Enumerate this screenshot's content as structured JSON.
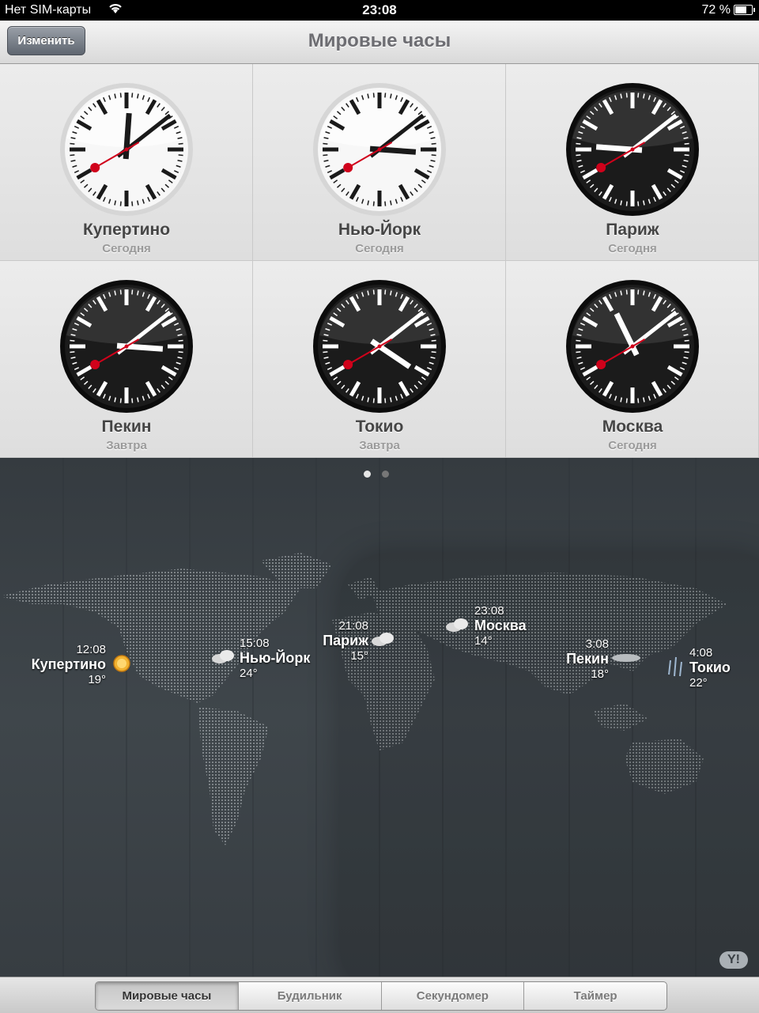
{
  "status": {
    "carrier": "Нет SIM-карты",
    "time": "23:08",
    "battery": "72 %",
    "battery_level": 0.72
  },
  "navbar": {
    "title": "Мировые часы",
    "edit_label": "Изменить"
  },
  "clocks": [
    {
      "city": "Купертино",
      "day": "Сегодня",
      "theme": "light",
      "hour": 12,
      "minute": 8,
      "second": 40
    },
    {
      "city": "Нью-Йорк",
      "day": "Сегодня",
      "theme": "light",
      "hour": 15,
      "minute": 8,
      "second": 40
    },
    {
      "city": "Париж",
      "day": "Сегодня",
      "theme": "dark",
      "hour": 21,
      "minute": 8,
      "second": 40
    },
    {
      "city": "Пекин",
      "day": "Завтра",
      "theme": "dark",
      "hour": 3,
      "minute": 8,
      "second": 40
    },
    {
      "city": "Токио",
      "day": "Завтра",
      "theme": "dark",
      "hour": 4,
      "minute": 8,
      "second": 40
    },
    {
      "city": "Москва",
      "day": "Сегодня",
      "theme": "dark",
      "hour": 23,
      "minute": 8,
      "second": 40
    }
  ],
  "pager": {
    "pages": 2,
    "current": 1
  },
  "map_markers": [
    {
      "city": "Купертино",
      "time": "12:08",
      "temp": "19°",
      "weather": "sun-icon"
    },
    {
      "city": "Нью-Йорк",
      "time": "15:08",
      "temp": "24°",
      "weather": "cloud-icon"
    },
    {
      "city": "Париж",
      "time": "21:08",
      "temp": "15°",
      "weather": "cloud-icon"
    },
    {
      "city": "Москва",
      "time": "23:08",
      "temp": "14°",
      "weather": "cloud-icon"
    },
    {
      "city": "Пекин",
      "time": "3:08",
      "temp": "18°",
      "weather": "cloud-icon"
    },
    {
      "city": "Токио",
      "time": "4:08",
      "temp": "22°",
      "weather": "rain-icon"
    }
  ],
  "tabs": [
    "Мировые часы",
    "Будильник",
    "Секундомер",
    "Таймер"
  ],
  "active_tab": 0,
  "brand": {
    "logo": "Y!"
  },
  "colors": {
    "second_hand": "#d0021b",
    "dark_face": "#1b1b1b",
    "light_face": "#f7f7f7"
  }
}
